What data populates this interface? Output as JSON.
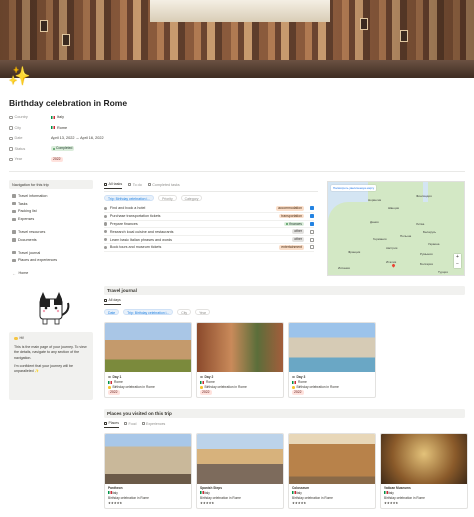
{
  "page": {
    "icon": "sparkles-icon",
    "title": "Birthday celebration in Rome",
    "properties": [
      {
        "key": "Country",
        "icon": "globe-icon",
        "value": "Italy",
        "type": "flag"
      },
      {
        "key": "City",
        "icon": "pin-icon",
        "value": "Rome",
        "type": "flag"
      },
      {
        "key": "Date",
        "icon": "calendar-icon",
        "value": "April 13, 2022 → April 16, 2022",
        "type": "text"
      },
      {
        "key": "Status",
        "icon": "status-icon",
        "value": "Completed",
        "type": "pill-green"
      },
      {
        "key": "Year",
        "icon": "list-icon",
        "value": "2022",
        "type": "pill-red"
      }
    ]
  },
  "nav": {
    "title": "Navigation for this trip",
    "group1": [
      "Travel information",
      "Tasks",
      "Packing list",
      "Expenses"
    ],
    "group2": [
      "Travel resources",
      "Documents"
    ],
    "group3": [
      "Travel journal",
      "Places and experiences"
    ],
    "home": "Home"
  },
  "callout": {
    "hi": "Hi!",
    "p1": "This is the main page of your journey. To view the details, navigate to any section of the navigation.",
    "p2": "I'm confident that your journey will be unparalleled ✨"
  },
  "tasks": {
    "tabs": [
      "All tasks",
      "To do",
      "Completed tasks"
    ],
    "filters": {
      "trip": "Trip: Birthday celebration i...",
      "priority": "Priority",
      "category": "Category"
    },
    "rows": [
      {
        "name": "Find and book a hotel",
        "category": "accommodation",
        "cat_color": "orange",
        "done": true
      },
      {
        "name": "Purchase transportation tickets",
        "category": "transportation",
        "cat_color": "orange",
        "done": true
      },
      {
        "name": "Prepare finances",
        "category": "finances",
        "cat_color": "green",
        "done": true
      },
      {
        "name": "Research local cuisine and restaurants",
        "category": "other",
        "cat_color": "gray",
        "done": false
      },
      {
        "name": "Learn basic Italian phrases and words",
        "category": "other",
        "cat_color": "gray",
        "done": false
      },
      {
        "name": "Book tours and museum tickets",
        "category": "entertainment",
        "cat_color": "orange",
        "done": false
      }
    ]
  },
  "map": {
    "badge": "Посмотреть увеличенную карту",
    "labels": [
      "Норвегия",
      "Швеция",
      "Финляндия",
      "Дания",
      "Литва",
      "Беларусь",
      "Польша",
      "Германия",
      "Украина",
      "Франция",
      "Австрия",
      "Румыния",
      "Италия",
      "Испания",
      "Болгария",
      "Турция"
    ],
    "zoom_in": "+",
    "zoom_out": "−"
  },
  "journal": {
    "title": "Travel journal",
    "tab": "All days",
    "filters": {
      "date": "Date",
      "trip": "Trip: Birthday celebration i...",
      "city": "City",
      "year": "Year"
    },
    "cards": [
      {
        "day": "Day 1",
        "city": "Rome",
        "trip": "Birthday celebration in Rome",
        "year": "2022"
      },
      {
        "day": "Day 2",
        "city": "Rome",
        "trip": "Birthday celebration in Rome",
        "year": "2022"
      },
      {
        "day": "Day 3",
        "city": "Rome",
        "trip": "Birthday celebration in Rome",
        "year": "2022"
      }
    ]
  },
  "places": {
    "title": "Places you visited on this trip",
    "tabs": [
      "Places",
      "Food",
      "Experiences"
    ],
    "cards": [
      {
        "name": "Pantheon",
        "country": "Italy",
        "trip": "Birthday celebration in Rome",
        "rating": "★★★★★"
      },
      {
        "name": "Spanish Steps",
        "country": "Italy",
        "trip": "Birthday celebration in Rome",
        "rating": "★★★★★"
      },
      {
        "name": "Colosseum",
        "country": "Italy",
        "trip": "Birthday celebration in Rome",
        "rating": "★★★★★"
      },
      {
        "name": "Vatican Museums",
        "country": "Italy",
        "trip": "Birthday celebration in Rome",
        "rating": "★★★★★"
      }
    ]
  },
  "colors": {
    "accent": "#2383e2",
    "completed": "#dbeddb",
    "sidebar_bg": "#f1f1ef"
  }
}
